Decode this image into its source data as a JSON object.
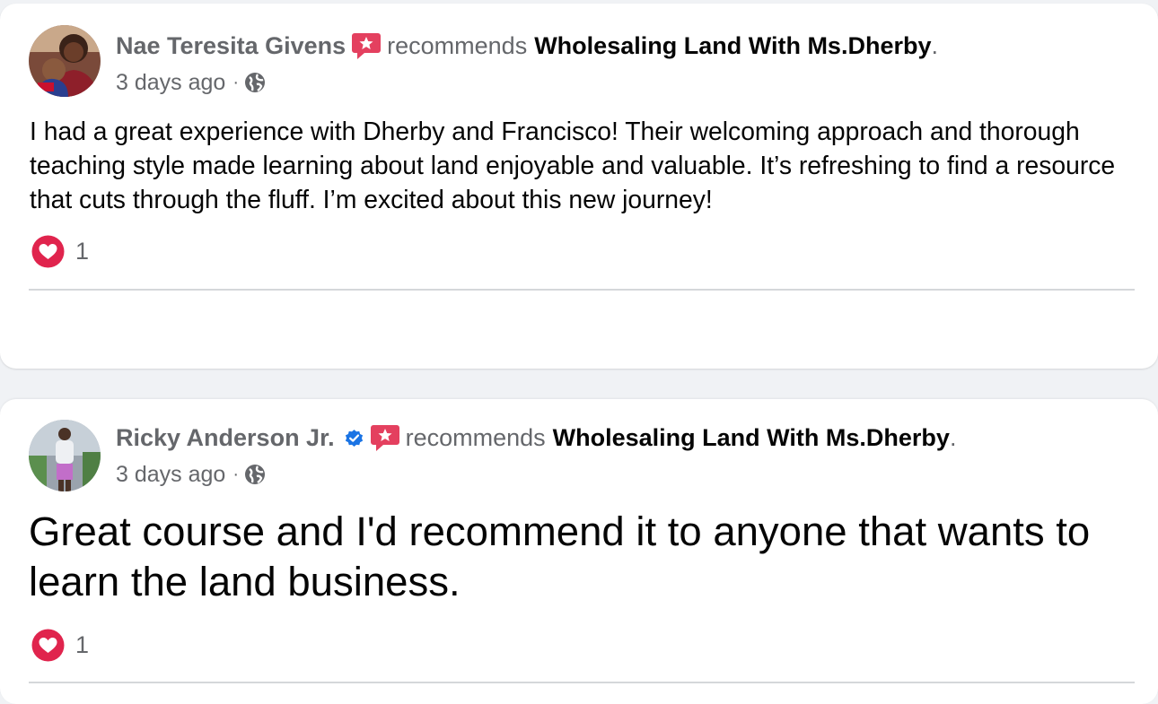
{
  "posts": [
    {
      "author": "Nae Teresita Givens",
      "verified": false,
      "verb": "recommends",
      "page": "Wholesaling Land With Ms.Dherby",
      "end_punct": ".",
      "time": "3 days ago",
      "sep": "·",
      "text": "I had a great experience with Dherby and Francisco! Their welcoming approach and thorough teaching style made learning about land enjoyable and valuable. It’s refreshing to find a resource that cuts through the fluff. I’m excited about this new journey!",
      "reaction_icon": "heart-icon",
      "reaction_count": "1"
    },
    {
      "author": "Ricky Anderson Jr.",
      "verified": true,
      "verb": "recommends",
      "page": "Wholesaling Land With Ms.Dherby",
      "end_punct": ".",
      "time": "3 days ago",
      "sep": "·",
      "text": "Great course and I'd recommend it to anyone that wants to learn the land business.",
      "reaction_icon": "heart-icon",
      "reaction_count": "1"
    }
  ],
  "colors": {
    "page_bg": "#f0f2f5",
    "card_bg": "#ffffff",
    "secondary_text": "#65676b",
    "primary_text": "#050505",
    "recommend_badge": "#e4405f",
    "heart": "#e0244d",
    "verified": "#1b74e4",
    "divider": "#d5d7da"
  }
}
